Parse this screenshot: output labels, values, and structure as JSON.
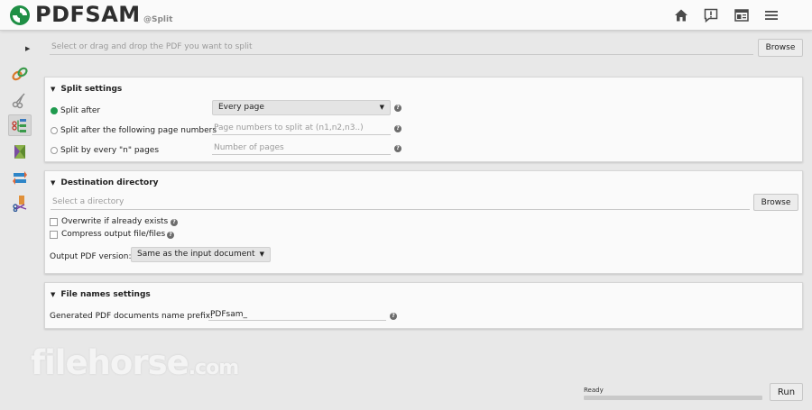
{
  "header": {
    "logo_text": "PDFSAM",
    "module_label": "@Split",
    "icons": [
      "home-icon",
      "feedback-icon",
      "news-icon",
      "menu-icon"
    ]
  },
  "sidebar": {
    "items": [
      "merge-icon",
      "split-by-bookmarks-icon",
      "split-icon",
      "alternate-mix-icon",
      "rotate-icon",
      "extract-icon"
    ],
    "active": "split-icon"
  },
  "selection": {
    "placeholder": "Select or drag and drop the PDF you want to split",
    "browse_label": "Browse"
  },
  "split_settings": {
    "title": "Split settings",
    "option_split_after": "Split after",
    "split_after_value": "Every page",
    "option_page_numbers": "Split after the following page numbers",
    "page_numbers_placeholder": "Page numbers to split at (n1,n2,n3..)",
    "option_every_n": "Split by every \"n\" pages",
    "every_n_placeholder": "Number of pages",
    "help": "?"
  },
  "destination": {
    "title": "Destination directory",
    "placeholder": "Select a directory",
    "browse_label": "Browse",
    "overwrite_label": "Overwrite if already exists",
    "compress_label": "Compress output file/files",
    "version_label": "Output PDF version:",
    "version_value": "Same as the input document",
    "help": "?"
  },
  "file_names": {
    "title": "File names settings",
    "prefix_label": "Generated PDF documents name prefix:",
    "prefix_value": "PDFsam_",
    "help": "?"
  },
  "footer": {
    "status_text": "Ready",
    "progress": 0,
    "run_label": "Run"
  },
  "watermark": {
    "text": "filehorse",
    "suffix": ".com"
  },
  "colors": {
    "accent": "#1f9a4e",
    "background": "#e8e8e8",
    "panel": "#fafafa"
  }
}
